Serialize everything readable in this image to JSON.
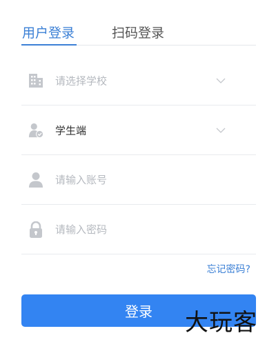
{
  "tabs": {
    "password_login": "用户登录",
    "qr_login": "扫码登录"
  },
  "form": {
    "school": {
      "placeholder": "请选择学校"
    },
    "role": {
      "value": "学生端"
    },
    "account": {
      "placeholder": "请输入账号"
    },
    "password": {
      "placeholder": "请输入密码"
    }
  },
  "forgot_password": "忘记密码?",
  "login_button": "登录",
  "watermark": "大玩客",
  "colors": {
    "accent": "#3a7fd5",
    "button": "#3384f2",
    "icon": "#c4c7cc",
    "placeholder": "#b5b9bf",
    "divider": "#e8eaed"
  }
}
